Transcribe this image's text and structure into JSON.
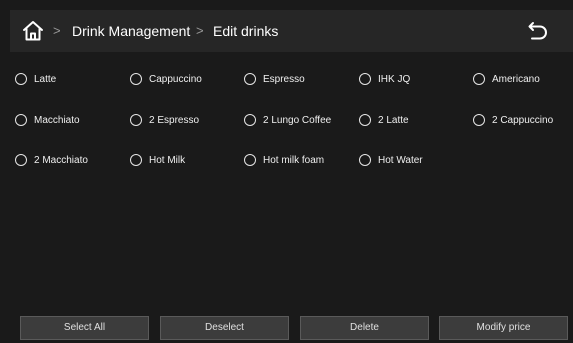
{
  "header": {
    "breadcrumb": [
      "Drink Management",
      "Edit drinks"
    ],
    "separator": ">",
    "home_icon": "home-icon",
    "back_icon": "back-arrow-icon"
  },
  "drinks": [
    {
      "label": "Latte",
      "selected": false
    },
    {
      "label": "Cappuccino",
      "selected": false
    },
    {
      "label": "Espresso",
      "selected": false
    },
    {
      "label": "IHK JQ",
      "selected": false
    },
    {
      "label": "Americano",
      "selected": false
    },
    {
      "label": "Macchiato",
      "selected": false
    },
    {
      "label": "2 Espresso",
      "selected": false
    },
    {
      "label": "2 Lungo Coffee",
      "selected": false
    },
    {
      "label": "2 Latte",
      "selected": false
    },
    {
      "label": "2 Cappuccino",
      "selected": false
    },
    {
      "label": "2 Macchiato",
      "selected": false
    },
    {
      "label": "Hot Milk",
      "selected": false
    },
    {
      "label": "Hot milk foam",
      "selected": false
    },
    {
      "label": "Hot Water",
      "selected": false
    }
  ],
  "actions": {
    "select_all": "Select All",
    "deselect": "Deselect",
    "delete": "Delete",
    "modify_price": "Modify price"
  },
  "colors": {
    "background": "#1a1a1a",
    "topbar": "#262626",
    "button": "#3c3c3c",
    "text": "#ffffff"
  }
}
